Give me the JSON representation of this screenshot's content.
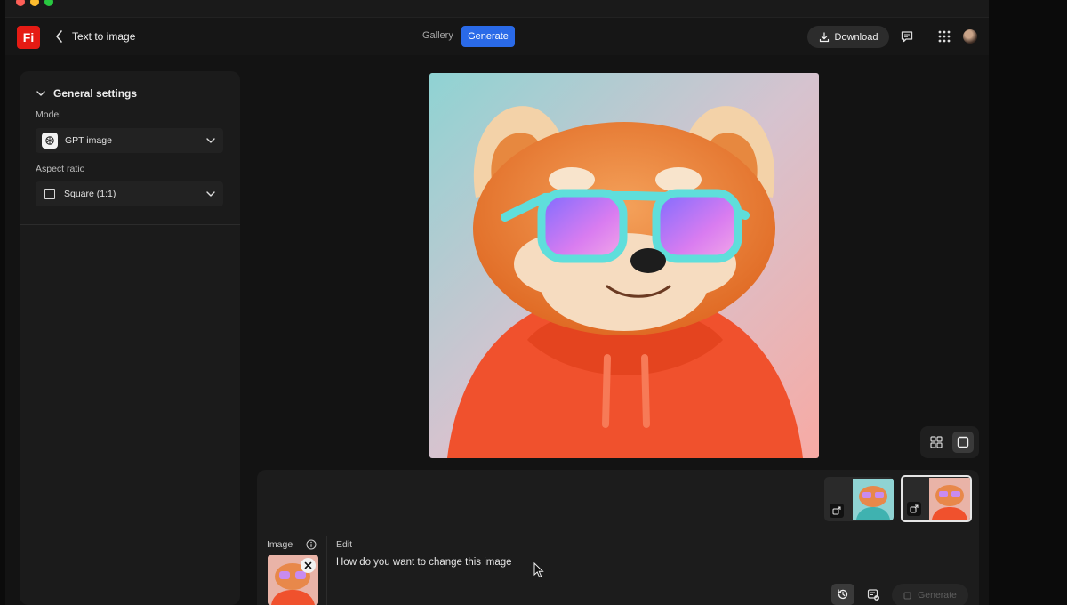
{
  "app": {
    "logo_text": "Fi",
    "title": "Text to image"
  },
  "nav": {
    "gallery_label": "Gallery",
    "generate_label": "Generate",
    "download_label": "Download"
  },
  "sidebar": {
    "section_title": "General settings",
    "model_label": "Model",
    "model_value": "GPT image",
    "aspect_label": "Aspect ratio",
    "aspect_value": "Square (1:1)"
  },
  "editor": {
    "image_label": "Image",
    "edit_label": "Edit",
    "prompt_placeholder": "How do you want to change this image",
    "generate_label": "Generate"
  },
  "colors": {
    "accent": "#2a6ae8",
    "brand": "#e51b14"
  }
}
